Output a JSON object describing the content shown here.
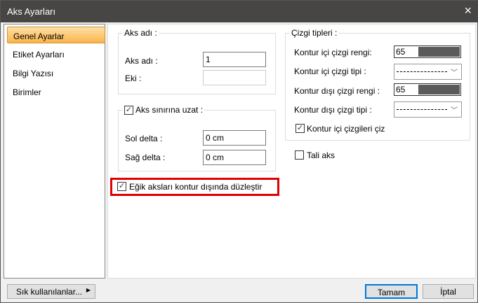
{
  "window": {
    "title": "Aks Ayarları",
    "close_icon": "×"
  },
  "sidebar": {
    "items": [
      {
        "label": "Genel Ayarlar",
        "selected": true
      },
      {
        "label": "Etiket Ayarları"
      },
      {
        "label": "Bilgi Yazısı"
      },
      {
        "label": "Birimler"
      }
    ]
  },
  "aks_group": {
    "title": "Aks adı :",
    "name_label": "Aks adı :",
    "name_value": "1",
    "eki_label": "Eki :",
    "eki_value": ""
  },
  "extend_group": {
    "title": "Aks sınırına uzat :",
    "checked": true,
    "sol_label": "Sol delta :",
    "sol_value": "0 cm",
    "sag_label": "Sağ delta :",
    "sag_value": "0 cm"
  },
  "flatten": {
    "label": "Eğik aksları kontur dışında düzleştir",
    "checked": true,
    "highlight": "#e00000"
  },
  "line_types": {
    "title": "Çizgi tipleri :",
    "inner_color_label": "Kontur içi çizgi rengi:",
    "inner_color_value": "65",
    "inner_type_label": "Kontur içi çizgi tipi :",
    "outer_color_label": "Kontur dışı çizgi rengi :",
    "outer_color_value": "65",
    "outer_type_label": "Kontur dışı çizgi tipi :",
    "draw_inner_label": "Kontur içi çizgileri çiz",
    "draw_inner_checked": true,
    "swatch_color": "#5a5a5a"
  },
  "tali": {
    "label": "Tali aks",
    "checked": false
  },
  "footer": {
    "frequent": "Sık kullanılanlar...",
    "ok": "Tamam",
    "cancel": "İptal"
  }
}
